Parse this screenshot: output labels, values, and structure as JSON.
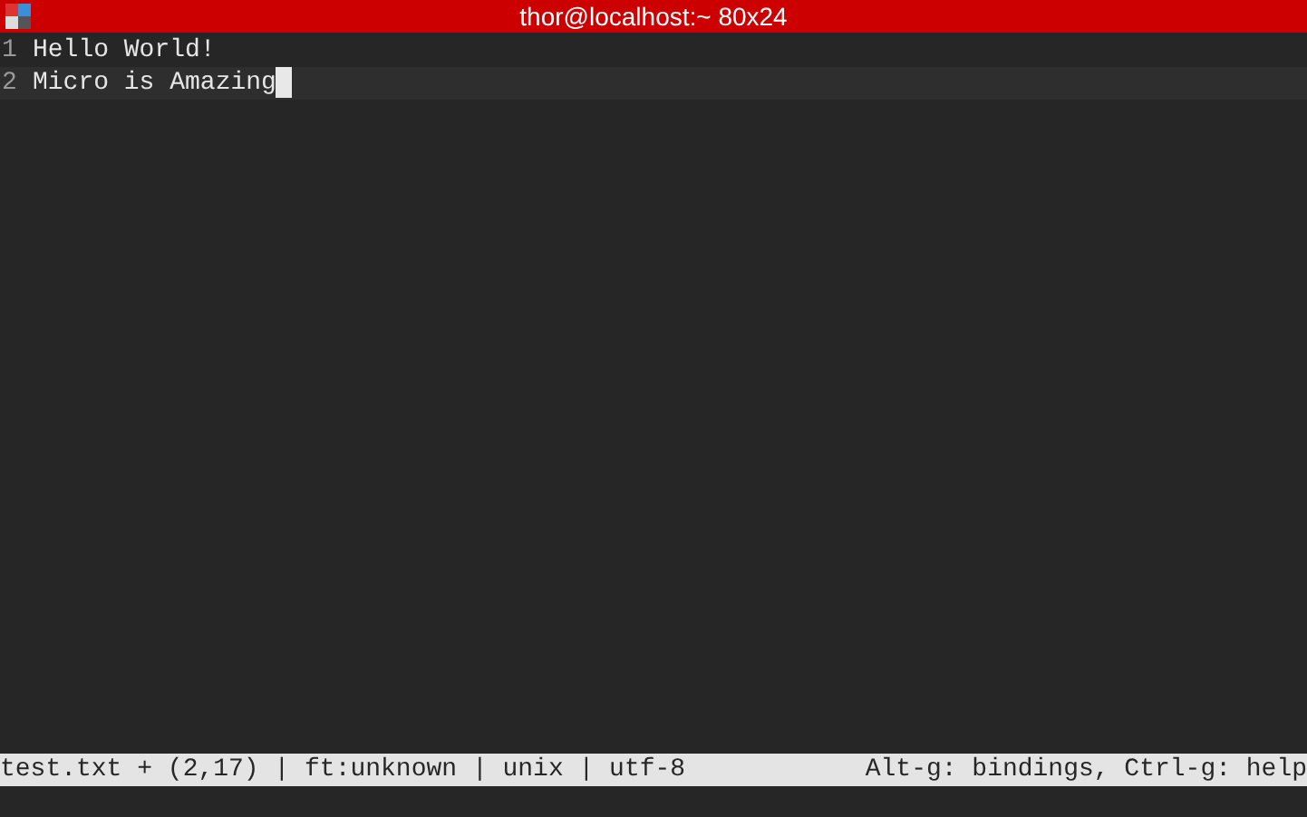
{
  "window": {
    "title": "thor@localhost:~ 80x24"
  },
  "editor": {
    "lines": [
      {
        "number": "1",
        "text": "Hello World!",
        "current": false
      },
      {
        "number": "2",
        "text": "Micro is Amazing",
        "current": true
      }
    ]
  },
  "status_bar": {
    "left": "test.txt + (2,17) | ft:unknown | unix | utf-8",
    "right": "Alt-g: bindings, Ctrl-g: help"
  }
}
